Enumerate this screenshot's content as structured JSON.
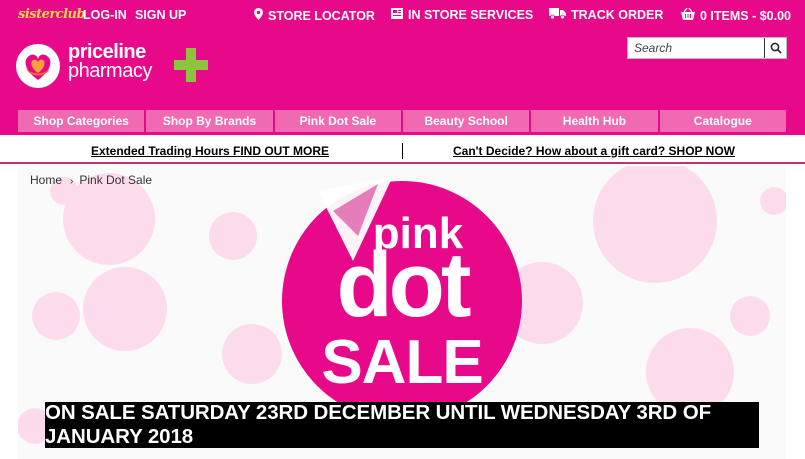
{
  "topbar": {
    "sisterclub": "sisterclub",
    "login": "LOG-IN",
    "signup": "SIGN UP",
    "store_locator": "STORE LOCATOR",
    "in_store_services": "IN STORE SERVICES",
    "track_order": "TRACK ORDER",
    "cart": "0 ITEMS - $0.00"
  },
  "logo": {
    "line1": "priceline",
    "line2": "pharmacy"
  },
  "search": {
    "placeholder": "Search"
  },
  "nav": {
    "items": [
      "Shop Categories",
      "Shop By Brands",
      "Pink Dot Sale",
      "Beauty School",
      "Health Hub",
      "Catalogue"
    ]
  },
  "promo": {
    "left": "Extended Trading Hours FIND OUT MORE",
    "right": "Can't Decide?  How about a gift card? SHOP NOW"
  },
  "breadcrumb": {
    "home": "Home",
    "current": "Pink Dot Sale"
  },
  "banner": {
    "word1": "pink",
    "word2": "dot",
    "word3": "SALE",
    "tagline": "ON SALE SATURDAY 23RD DECEMBER UNTIL WEDNESDAY 3RD OF JANUARY 2018"
  },
  "colors": {
    "brand_pink": "#e8098b",
    "nav_pink": "#f06ab1",
    "dot_light": "#fcdcec",
    "sisterclub_yellow": "#ffd84a",
    "logo_green": "#8cc63f"
  }
}
